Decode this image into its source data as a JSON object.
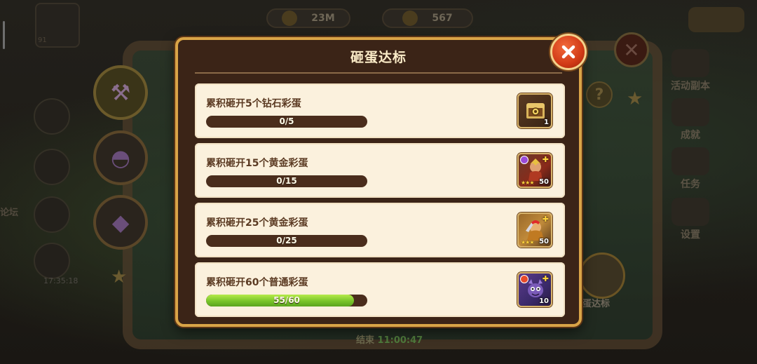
{
  "background": {
    "resources": [
      "23M",
      "567"
    ],
    "avatar_level": "91",
    "left_side_text": "论坛",
    "left_side_time": "17:35:18",
    "right_menu": [
      "活动副本",
      "成就",
      "任务",
      "设置"
    ],
    "egg_entry_label": "砸蛋达标",
    "bottom_timer_prefix": "结束",
    "bottom_timer_time": "11:00:47"
  },
  "modal": {
    "title": "砸蛋达标",
    "close_icon": "close-x-icon"
  },
  "tasks": [
    {
      "label": "累积砸开5个钻石彩蛋",
      "current": 0,
      "target": 5,
      "progress_text": "0/5",
      "progress": 0.0,
      "reward_icon": "treasure-chest-icon",
      "reward_count": "1"
    },
    {
      "label": "累积砸开15个黄金彩蛋",
      "current": 0,
      "target": 15,
      "progress_text": "0/15",
      "progress": 0.0,
      "reward_icon": "hero-shard-icon",
      "reward_count": "50"
    },
    {
      "label": "累积砸开25个黄金彩蛋",
      "current": 0,
      "target": 25,
      "progress_text": "0/25",
      "progress": 0.0,
      "reward_icon": "hero-shard-icon",
      "reward_count": "50"
    },
    {
      "label": "累积砸开60个普通彩蛋",
      "current": 55,
      "target": 60,
      "progress_text": "55/60",
      "progress": 0.9167,
      "reward_icon": "dragon-shard-icon",
      "reward_count": "10"
    }
  ],
  "colors": {
    "modal_border": "#d9a447",
    "modal_bg": "#3b2417",
    "row_bg": "#fbf1dd",
    "bar_track": "#4a2d1c",
    "bar_fill": "#78c52a",
    "close_btn": "#d13a16"
  }
}
